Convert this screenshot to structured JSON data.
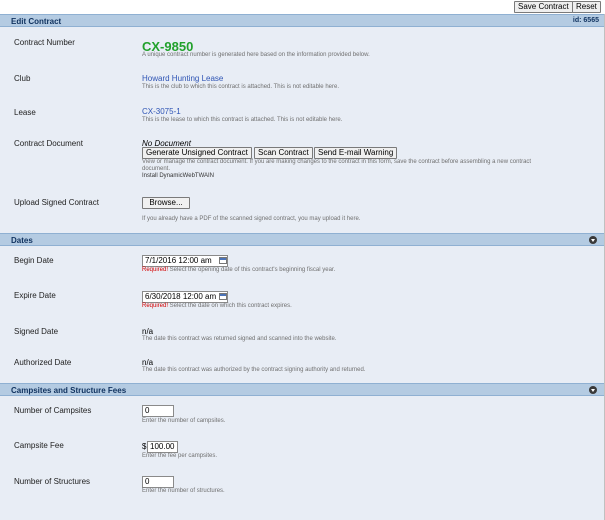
{
  "toolbar": {
    "save_label": "Save Contract",
    "reset_label": "Reset"
  },
  "edit_contract": {
    "title": "Edit Contract",
    "id_text": "id: 6565",
    "contract_number": {
      "label": "Contract Number",
      "value": "CX-9850",
      "help": "A unique contract number is generated here based on the information provided below."
    },
    "club": {
      "label": "Club",
      "value": "Howard Hunting Lease",
      "help": "This is the club to which this contract is attached. This is not editable here."
    },
    "lease": {
      "label": "Lease",
      "value": "CX-3075-1",
      "help": "This is the lease to which this contract is attached. This is not editable here."
    },
    "contract_document": {
      "label": "Contract Document",
      "status": "No Document",
      "buttons": [
        "Generate Unsigned Contract",
        "Scan Contract",
        "Send E-mail Warning"
      ],
      "help_line1": "View or manage the contract document. If you are making changes to the contract in this form, save the contract before assembling a new contract",
      "help_line2": "document.",
      "install": "Install DynamicWebTWAIN"
    },
    "upload": {
      "label": "Upload Signed Contract",
      "button": "Browse...",
      "help": "If you already have a PDF of the scanned signed contract, you may upload it here."
    }
  },
  "dates": {
    "title": "Dates",
    "begin": {
      "label": "Begin Date",
      "value": "7/1/2016 12:00 am",
      "required": "Required!",
      "help": " Select the opening date of this contract's beginning fiscal year."
    },
    "expire": {
      "label": "Expire Date",
      "value": "6/30/2018 12:00 am",
      "required": "Required!",
      "help": " Select the date on which this contract expires."
    },
    "signed": {
      "label": "Signed Date",
      "value": "n/a",
      "help": "The date this contract was returned signed and scanned into the website."
    },
    "authorized": {
      "label": "Authorized Date",
      "value": "n/a",
      "help": "The date this contract was authorized by the contract signing authority and returned."
    }
  },
  "campsites": {
    "title": "Campsites and Structure Fees",
    "num_campsites": {
      "label": "Number of Campsites",
      "value": "0",
      "help": "Enter the number of campsites."
    },
    "campsite_fee": {
      "label": "Campsite Fee",
      "prefix": "$",
      "value": "100.00",
      "help": "Enter the fee per campsites."
    },
    "num_structures": {
      "label": "Number of Structures",
      "value": "0",
      "help": "Enter the number of structures."
    }
  }
}
